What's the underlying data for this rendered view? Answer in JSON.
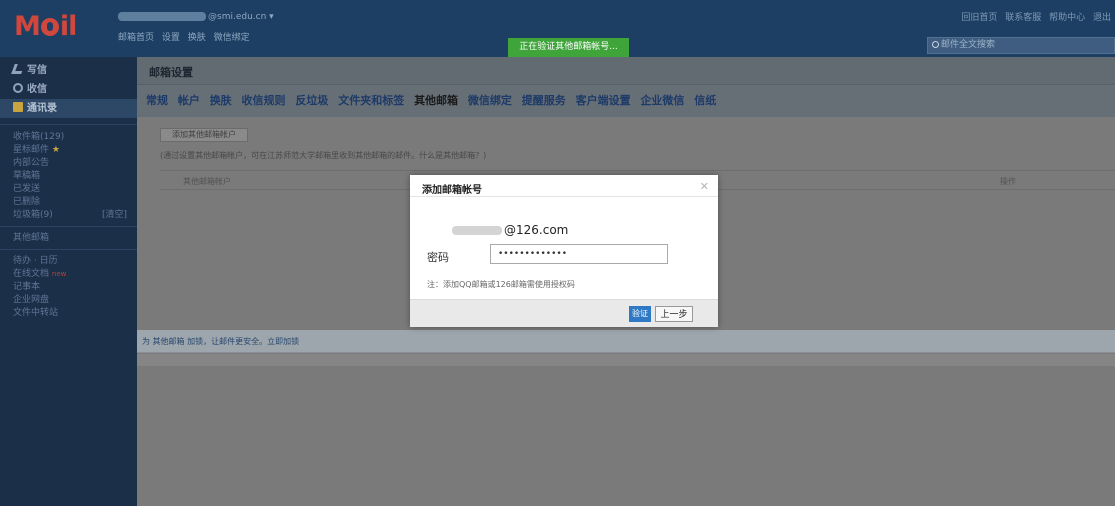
{
  "header": {
    "logo": "M",
    "logo_suffix": "il",
    "user_email": "@smi.edu.cn",
    "nav_links": [
      "邮箱首页",
      "设置",
      "换肤",
      "微信绑定"
    ],
    "verify_banner": "正在验证其他邮箱帐号...",
    "right_links": [
      "回旧首页",
      "联系客服",
      "帮助中心",
      "退出"
    ],
    "search_placeholder": "邮件全文搜索"
  },
  "sidebar": {
    "main": [
      {
        "label": "写信",
        "icon": "pencil-icon"
      },
      {
        "label": "收信",
        "icon": "inbox-icon"
      },
      {
        "label": "通讯录",
        "icon": "contacts-icon"
      }
    ],
    "folders": [
      {
        "label": "收件箱(129)"
      },
      {
        "label": "星标邮件"
      },
      {
        "label": "内部公告"
      },
      {
        "label": "草稿箱"
      },
      {
        "label": "已发送"
      },
      {
        "label": "已删除"
      },
      {
        "label": "垃圾箱(9)",
        "tail": "[清空]"
      },
      {
        "label": "其他邮箱"
      },
      {
        "label": "待办 · 日历"
      },
      {
        "label": "在线文档"
      },
      {
        "label": "记事本"
      },
      {
        "label": "企业网盘"
      },
      {
        "label": "文件中转站"
      }
    ]
  },
  "main": {
    "title": "邮箱设置",
    "tabs": [
      "常规",
      "帐户",
      "换肤",
      "收信规则",
      "反垃圾",
      "文件夹和标签",
      "其他邮箱",
      "微信绑定",
      "提醒服务",
      "客户端设置",
      "企业微信",
      "信纸"
    ],
    "add_button": "添加其他邮箱帐户",
    "add_desc": "(通过设置其他邮箱帐户，可在江苏师范大学邮箱里收到其他邮箱的邮件。什么是其他邮箱？)",
    "table_headers": {
      "account": "其他邮箱帐户",
      "op": "操作"
    },
    "promo": "为 其他邮箱 加锁，让邮件更安全。立即加锁"
  },
  "modal": {
    "title": "添加邮箱帐号",
    "email_suffix": "@126.com",
    "password_label": "密码",
    "password_value": "•••••••••••••",
    "note": "注：添加QQ邮箱或126邮箱需使用授权码",
    "verify_btn": "验证",
    "prev_btn": "上一步"
  },
  "colors": {
    "header_bg": "#1c3f63",
    "sidebar_bg": "#1b2f49",
    "logo": "#d0473d",
    "verify_banner": "#3fa53b",
    "primary_button": "#2f78c4"
  }
}
